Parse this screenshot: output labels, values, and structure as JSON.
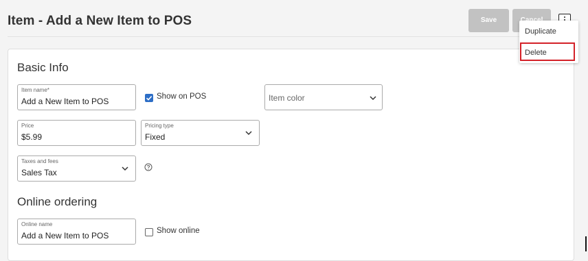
{
  "header": {
    "title": "Item - Add a New Item to POS",
    "save_label": "Save",
    "cancel_label": "Cancel"
  },
  "menu": {
    "items": [
      {
        "label": "Duplicate"
      },
      {
        "label": "Delete"
      }
    ],
    "highlight_color": "#d32027"
  },
  "basic_info": {
    "heading": "Basic Info",
    "item_name": {
      "label": "Item name*",
      "value": "Add a New Item to POS"
    },
    "show_on_pos": {
      "label": "Show on POS",
      "checked": true
    },
    "item_color": {
      "placeholder": "Item color"
    },
    "price": {
      "label": "Price",
      "value": "$5.99"
    },
    "pricing_type": {
      "label": "Pricing type",
      "value": "Fixed"
    },
    "taxes": {
      "label": "Taxes and fees",
      "value": "Sales Tax"
    }
  },
  "online_ordering": {
    "heading": "Online ordering",
    "online_name": {
      "label": "Online name",
      "value": "Add a New Item to POS"
    },
    "show_online": {
      "label": "Show online",
      "checked": false
    }
  },
  "icons": {
    "checkbox_checked": "check-icon",
    "dropdown": "chevron-down-icon",
    "help": "help-circle-icon",
    "overflow": "more-vertical-icon"
  },
  "colors": {
    "accent": "#2d6ec6",
    "disabled_button": "#c2c2c2"
  }
}
